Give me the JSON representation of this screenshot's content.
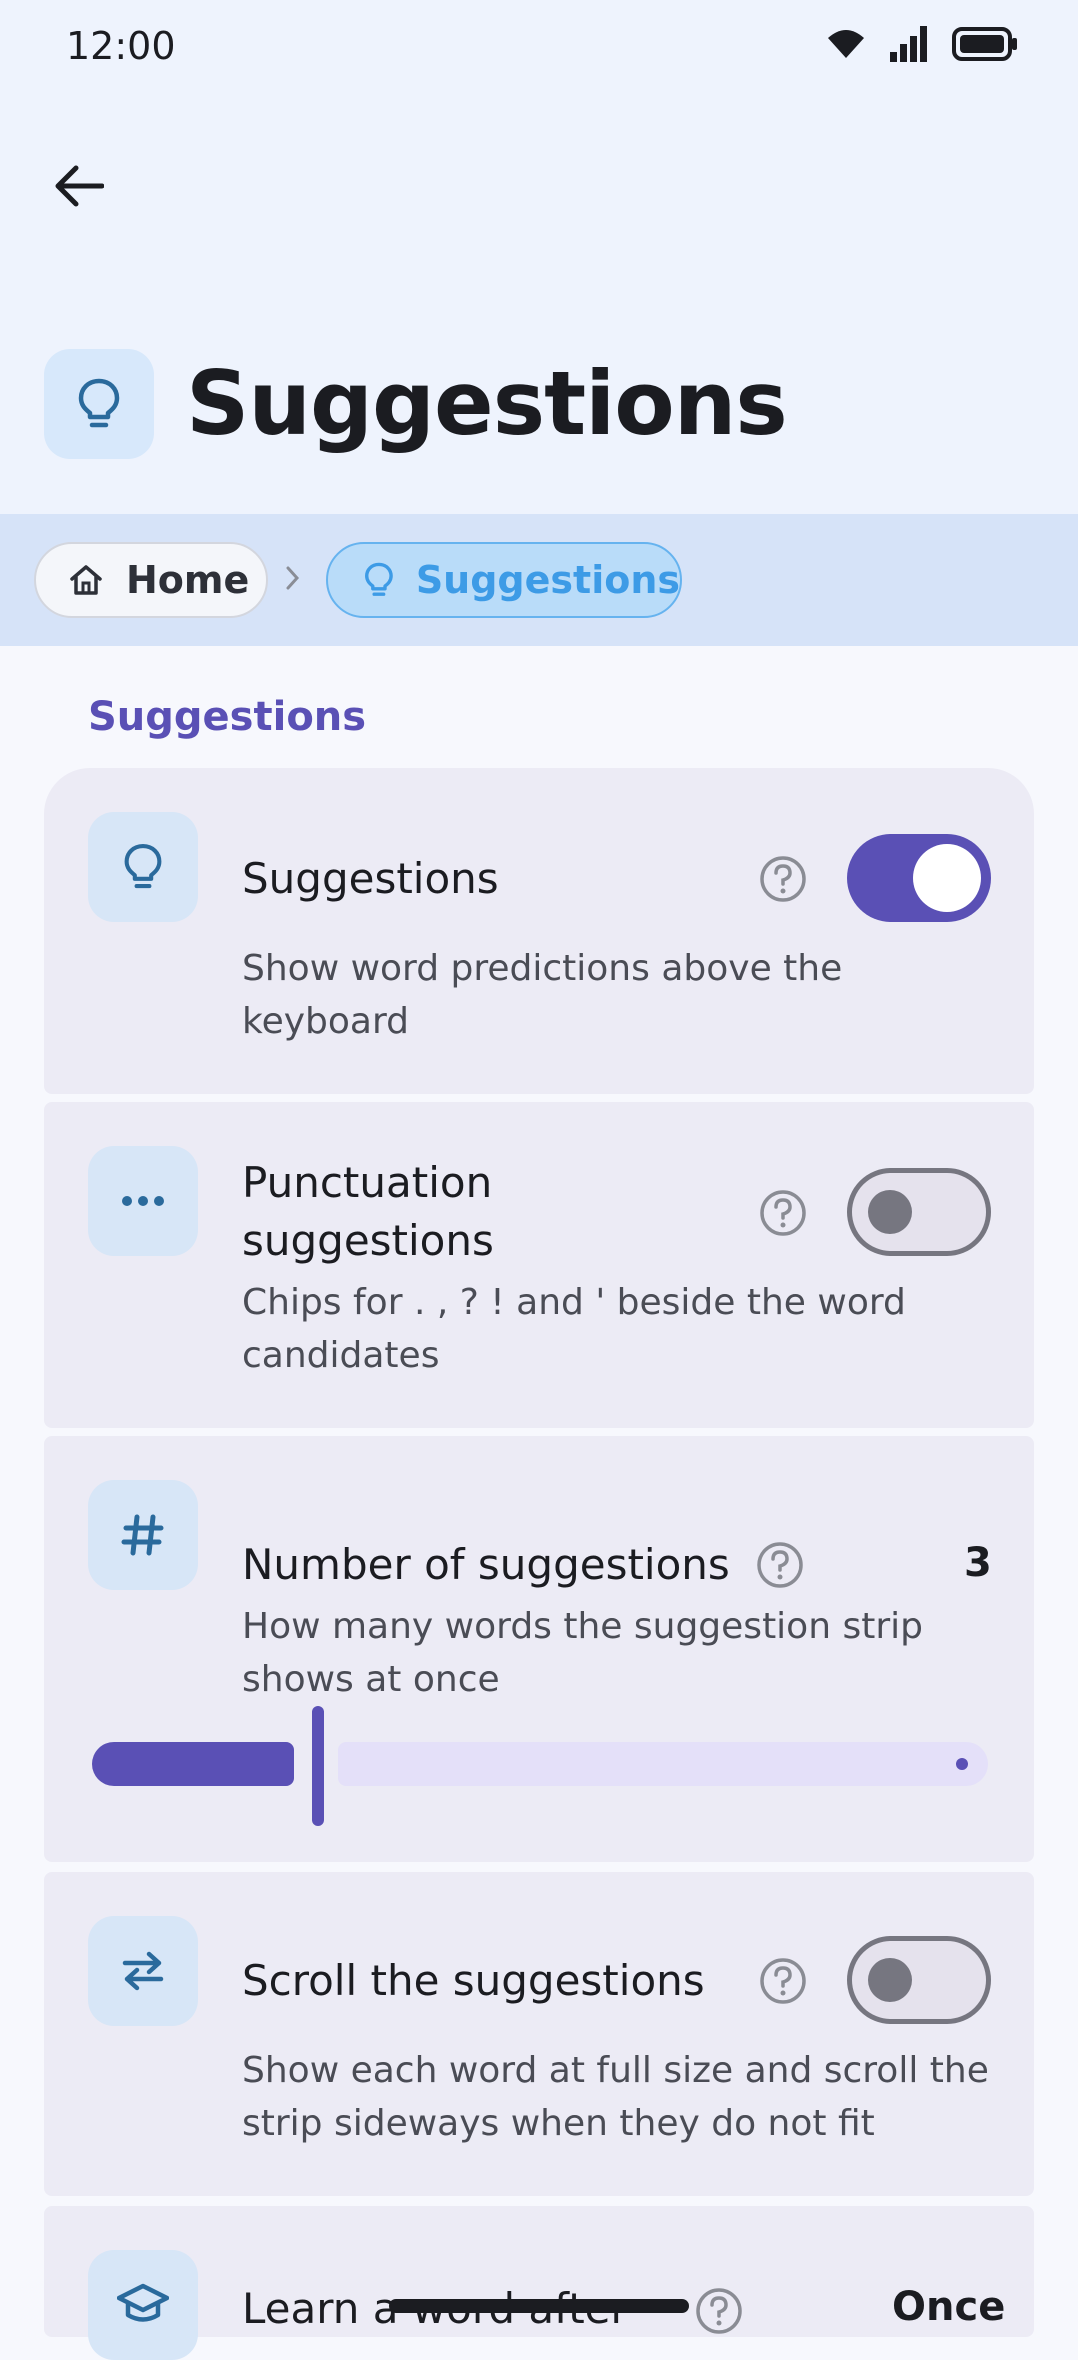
{
  "status_bar": {
    "time": "12:00"
  },
  "header": {
    "title": "Suggestions"
  },
  "breadcrumb": {
    "home": "Home",
    "current": "Suggestions"
  },
  "section": {
    "title": "Suggestions"
  },
  "settings": [
    {
      "title": "Suggestions",
      "description": "Show word predictions above the keyboard",
      "toggle": true
    },
    {
      "title": "Punctuation\nsuggestions",
      "description": "Chips for . , ? ! and ' beside the word candidates",
      "toggle": false
    },
    {
      "title": "Number of suggestions",
      "description": "How many words the suggestion strip shows at once",
      "value": "3",
      "slider_fraction": 0.25
    },
    {
      "title": "Scroll the suggestions",
      "description": "Show each word at full size and scroll the strip sideways when they do not fit",
      "toggle": false
    },
    {
      "title": "Learn a word after",
      "value": "Once"
    }
  ],
  "colors": {
    "accent": "#5a50b5",
    "icon_tint": "#2a6a9c",
    "crumb_active": "#3d9be6",
    "background": "#f7f8fd"
  }
}
